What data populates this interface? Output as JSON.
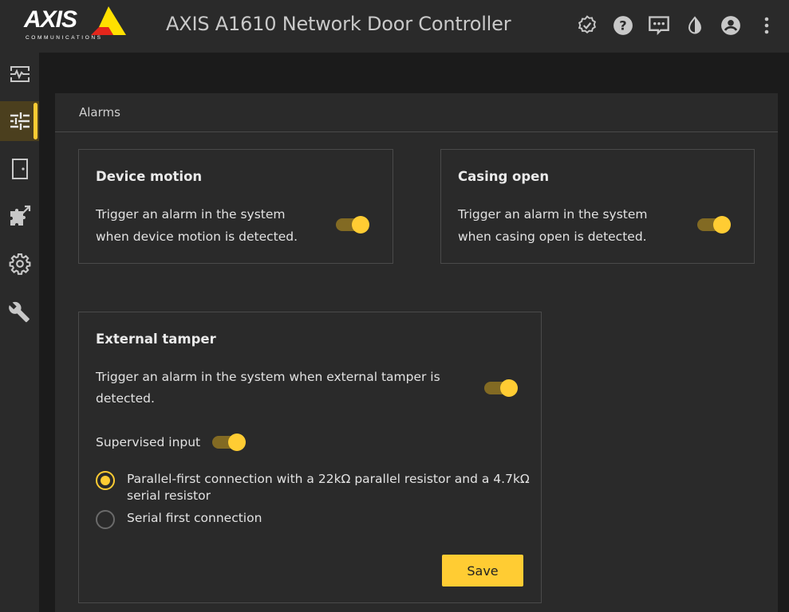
{
  "header": {
    "brand": "AXIS",
    "brand_sub": "COMMUNICATIONS",
    "title": "AXIS A1610 Network Door Controller",
    "icons": [
      "verified-badge-icon",
      "help-icon",
      "feedback-icon",
      "theme-contrast-icon",
      "account-icon",
      "more-vert-icon"
    ]
  },
  "sidebar": {
    "items": [
      {
        "name": "status",
        "icon": "status-monitor-icon",
        "active": false
      },
      {
        "name": "settings",
        "icon": "sliders-icon",
        "active": true
      },
      {
        "name": "door",
        "icon": "door-icon",
        "active": false
      },
      {
        "name": "apps",
        "icon": "puzzle-icon",
        "active": false
      },
      {
        "name": "system",
        "icon": "gear-icon",
        "active": false
      },
      {
        "name": "maintenance",
        "icon": "wrench-icon",
        "active": false
      }
    ]
  },
  "panel": {
    "title": "Alarms",
    "device_motion": {
      "title": "Device motion",
      "line1": "Trigger an alarm in the system",
      "line2": "when device motion is detected.",
      "enabled": true
    },
    "casing_open": {
      "title": "Casing open",
      "line1": "Trigger an alarm in the system",
      "line2": "when casing open is detected.",
      "enabled": true
    },
    "external_tamper": {
      "title": "External tamper",
      "line1": "Trigger an alarm in the system when external tamper is",
      "line2": "detected.",
      "enabled": true,
      "supervised_label": "Supervised input",
      "supervised_enabled": true,
      "options": [
        {
          "label_line1": "Parallel-first connection with a 22kΩ parallel resistor and a 4.7kΩ",
          "label_line2": "serial resistor",
          "checked": true
        },
        {
          "label_line1": "Serial first connection",
          "checked": false
        }
      ],
      "save_label": "Save"
    }
  },
  "colors": {
    "accent": "#ffcc33",
    "toggle_track": "#826a23",
    "active_nav_bg": "#4b3f1e",
    "surface": "#2a2a2a",
    "background": "#1b1b1b"
  }
}
